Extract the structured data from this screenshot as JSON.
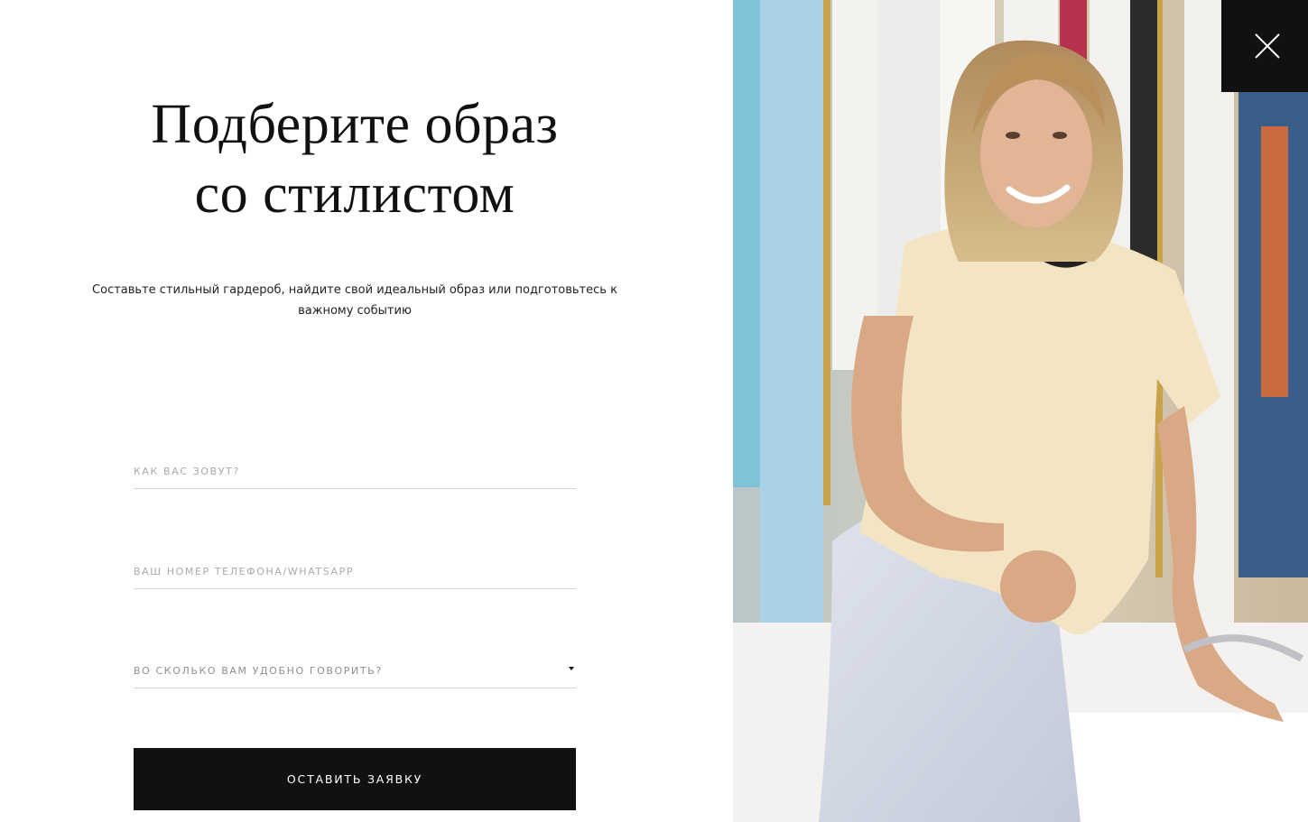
{
  "modal": {
    "title_line1": "Подберите образ",
    "title_line2": "со стилистом",
    "subtitle": "Составьте стильный гардероб, найдите свой идеальный образ или подготовьтесь к важному событию"
  },
  "form": {
    "name_placeholder": "КАК ВАС ЗОВУТ?",
    "phone_placeholder": "ВАШ НОМЕР ТЕЛЕФОНА/WHATSAPP",
    "time_select_label": "ВО СКОЛЬКО ВАМ УДОБНО ГОВОРИТЬ?",
    "submit_label": "ОСТАВИТЬ ЗАЯВКУ"
  },
  "icons": {
    "close": "close-icon",
    "dropdown": "caret-down-icon"
  },
  "colors": {
    "button_bg": "#111111",
    "button_text": "#ffffff",
    "placeholder": "#a9a9a9",
    "divider": "#d6d6d6"
  }
}
